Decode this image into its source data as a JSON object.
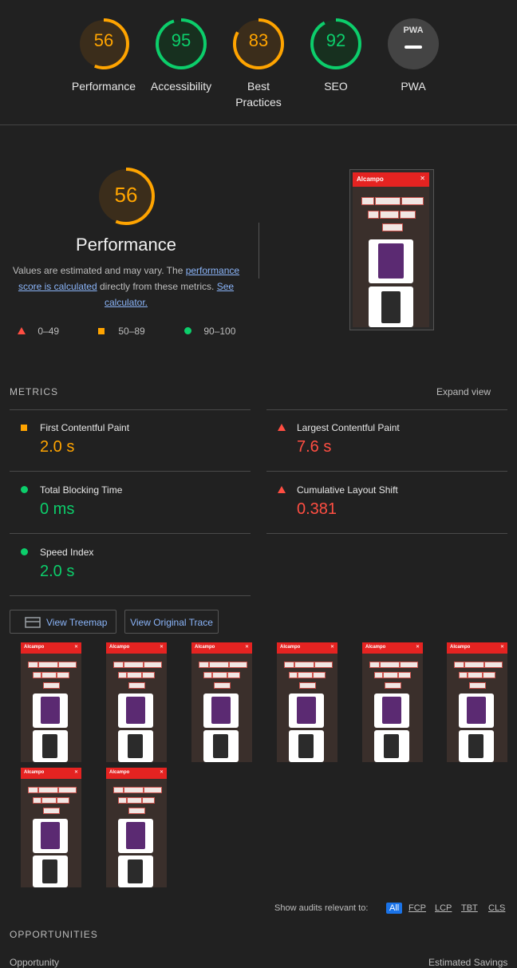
{
  "colors": {
    "fail": "#ff4e42",
    "average": "#ffa400",
    "pass": "#0cce6b",
    "link": "#8ab4f8",
    "accent": "#1a73e8"
  },
  "scores": [
    {
      "label": "Performance",
      "value": "56",
      "status": "average"
    },
    {
      "label": "Accessibility",
      "value": "95",
      "status": "pass"
    },
    {
      "label": "Best Practices",
      "value": "83",
      "status": "average"
    },
    {
      "label": "SEO",
      "value": "92",
      "status": "pass"
    },
    {
      "label": "PWA",
      "value": "PWA",
      "status": "na"
    }
  ],
  "performance": {
    "score": "56",
    "title": "Performance",
    "desc_prefix": "Values are estimated and may vary. The ",
    "desc_link1": "performance score is calculated",
    "desc_middle": " directly from these metrics. ",
    "desc_link2": "See calculator.",
    "legend": [
      {
        "icon": "triangle-icon",
        "label": "0–49"
      },
      {
        "icon": "square-icon",
        "label": "50–89"
      },
      {
        "icon": "circle-icon",
        "label": "90–100"
      }
    ]
  },
  "screenshot": {
    "logo": "Alcampo",
    "chips_row1": [
      "Todos",
      "Alimentación",
      "Congelados"
    ],
    "chips_row2": [
      "Sarti",
      "Droguería",
      "Bebidas"
    ],
    "chips_row3": [
      "Perfumería"
    ]
  },
  "metrics": {
    "heading": "METRICS",
    "expand": "Expand view",
    "items": [
      {
        "title": "First Contentful Paint",
        "value": "2.0 s",
        "status": "average"
      },
      {
        "title": "Largest Contentful Paint",
        "value": "7.6 s",
        "status": "fail"
      },
      {
        "title": "Total Blocking Time",
        "value": "0 ms",
        "status": "pass"
      },
      {
        "title": "Cumulative Layout Shift",
        "value": "0.381",
        "status": "fail"
      },
      {
        "title": "Speed Index",
        "value": "2.0 s",
        "status": "pass"
      }
    ]
  },
  "buttons": {
    "treemap": "View Treemap",
    "trace": "View Original Trace"
  },
  "filmstrip_count": 8,
  "filter": {
    "label": "Show audits relevant to:",
    "options": [
      "All",
      "FCP",
      "LCP",
      "TBT",
      "CLS"
    ],
    "active": "All"
  },
  "opportunities": {
    "heading": "OPPORTUNITIES",
    "col1": "Opportunity",
    "col2": "Estimated Savings"
  }
}
